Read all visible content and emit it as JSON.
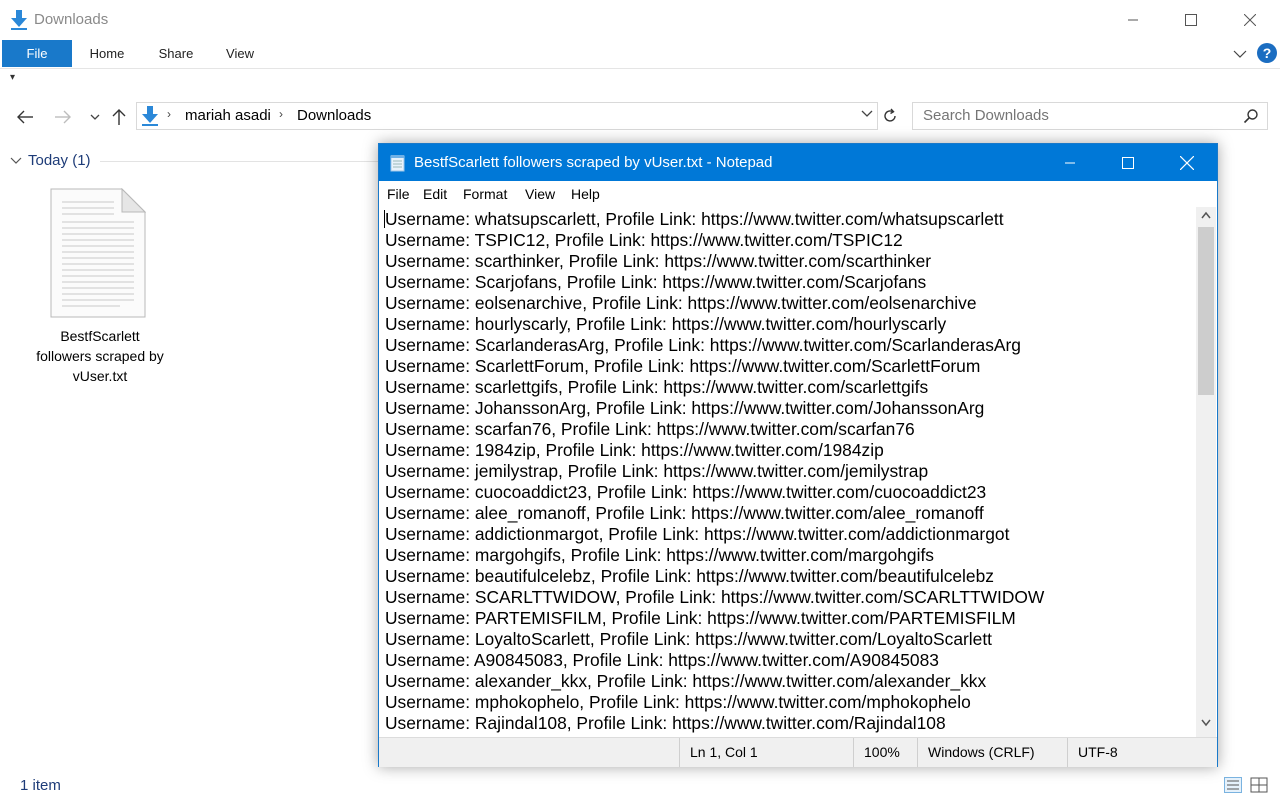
{
  "explorer": {
    "title": "Downloads",
    "ribbon_tabs": [
      "File",
      "Home",
      "Share",
      "View"
    ],
    "breadcrumb": [
      "mariah asadi",
      "Downloads"
    ],
    "search_placeholder": "Search Downloads",
    "group_header": "Today (1)",
    "file": {
      "name_lines": [
        "BestfScarlett",
        "followers scraped by",
        "vUser.txt"
      ]
    },
    "status_count": "1 item"
  },
  "notepad": {
    "title": "BestfScarlett followers scraped by vUser.txt - Notepad",
    "menu": [
      "File",
      "Edit",
      "Format",
      "View",
      "Help"
    ],
    "lines": [
      "Username: whatsupscarlett, Profile Link: https://www.twitter.com/whatsupscarlett",
      "Username: TSPIC12, Profile Link: https://www.twitter.com/TSPIC12",
      "Username: scarthinker, Profile Link: https://www.twitter.com/scarthinker",
      "Username: Scarjofans, Profile Link: https://www.twitter.com/Scarjofans",
      "Username: eolsenarchive, Profile Link: https://www.twitter.com/eolsenarchive",
      "Username: hourlyscarly, Profile Link: https://www.twitter.com/hourlyscarly",
      "Username: ScarlanderasArg, Profile Link: https://www.twitter.com/ScarlanderasArg",
      "Username: ScarlettForum, Profile Link: https://www.twitter.com/ScarlettForum",
      "Username: scarlettgifs, Profile Link: https://www.twitter.com/scarlettgifs",
      "Username: JohanssonArg, Profile Link: https://www.twitter.com/JohanssonArg",
      "Username: scarfan76, Profile Link: https://www.twitter.com/scarfan76",
      "Username: 1984zip, Profile Link: https://www.twitter.com/1984zip",
      "Username: jemilystrap, Profile Link: https://www.twitter.com/jemilystrap",
      "Username: cuocoaddict23, Profile Link: https://www.twitter.com/cuocoaddict23",
      "Username: alee_romanoff, Profile Link: https://www.twitter.com/alee_romanoff",
      "Username: addictionmargot, Profile Link: https://www.twitter.com/addictionmargot",
      "Username: margohgifs, Profile Link: https://www.twitter.com/margohgifs",
      "Username: beautifulcelebz, Profile Link: https://www.twitter.com/beautifulcelebz",
      "Username: SCARLTTWIDOW, Profile Link: https://www.twitter.com/SCARLTTWIDOW",
      "Username: PARTEMISFILM, Profile Link: https://www.twitter.com/PARTEMISFILM",
      "Username: LoyaltoScarlett, Profile Link: https://www.twitter.com/LoyaltoScarlett",
      "Username: A90845083, Profile Link: https://www.twitter.com/A90845083",
      "Username: alexander_kkx, Profile Link: https://www.twitter.com/alexander_kkx",
      "Username: mphokophelo, Profile Link: https://www.twitter.com/mphokophelo",
      "Username: Rajindal108, Profile Link: https://www.twitter.com/Rajindal108"
    ],
    "status": {
      "position": "Ln 1, Col 1",
      "zoom": "100%",
      "line_ending": "Windows (CRLF)",
      "encoding": "UTF-8"
    }
  },
  "colors": {
    "accent": "#0078d7",
    "ribbon_file": "#1979ca"
  }
}
